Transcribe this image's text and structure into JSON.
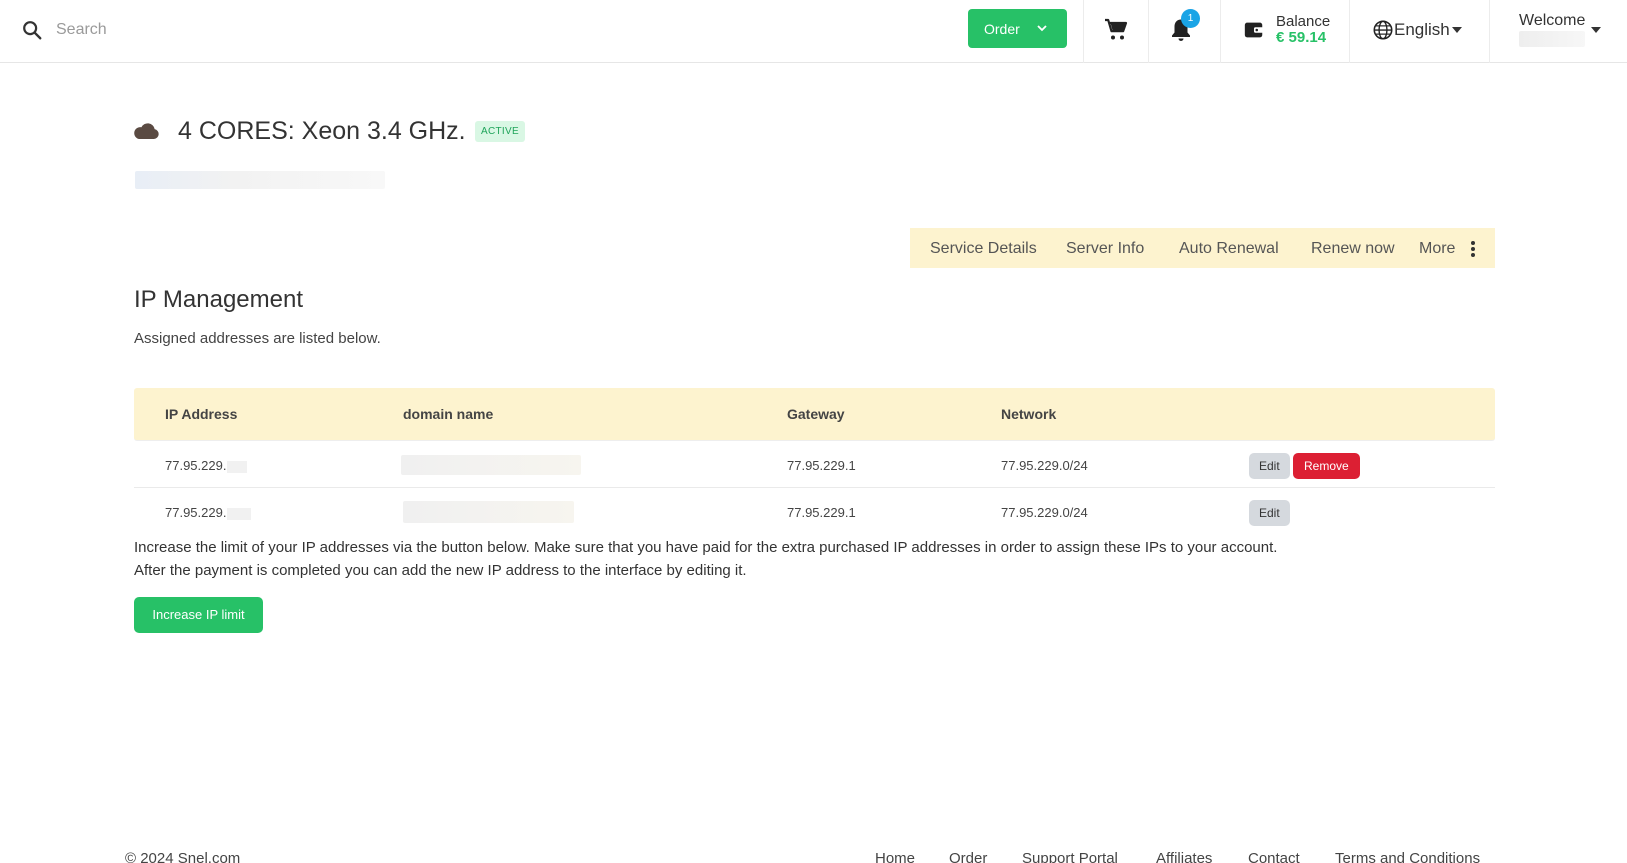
{
  "header": {
    "search_placeholder": "Search",
    "order_label": "Order",
    "notifications_count": "1",
    "balance_label": "Balance",
    "balance_value": "€ 59.14",
    "language": "English",
    "welcome_label": "Welcome",
    "icons": [
      "search-icon",
      "cart-icon",
      "bell-icon",
      "wallet-icon",
      "globe-icon",
      "chevron-down-icon"
    ]
  },
  "service": {
    "title": "4 CORES: Xeon 3.4 GHz.",
    "status": "ACTIVE",
    "icon": "cloud-icon"
  },
  "tabs": [
    {
      "label": "Service Details"
    },
    {
      "label": "Server Info"
    },
    {
      "label": "Auto Renewal"
    },
    {
      "label": "Renew now"
    },
    {
      "label": "More"
    }
  ],
  "ip_management": {
    "title": "IP Management",
    "description": "Assigned addresses are listed below.",
    "columns": [
      "IP Address",
      "domain name",
      "Gateway",
      "Network"
    ],
    "rows": [
      {
        "ip": "77.95.229.",
        "gateway": "77.95.229.1",
        "network": "77.95.229.0/24",
        "edit": "Edit",
        "remove": "Remove"
      },
      {
        "ip": "77.95.229.",
        "gateway": "77.95.229.1",
        "network": "77.95.229.0/24",
        "edit": "Edit"
      }
    ],
    "info_line_1": "Increase the limit of your IP addresses via the button below. Make sure that you have paid for the extra purchased IP addresses in order to assign these IPs to your account.",
    "info_line_2": "After the payment is completed you can add the new IP address to the interface by editing it.",
    "increase_button": "Increase IP limit"
  },
  "footer": {
    "copyright": "© 2024 Snel.com",
    "links": [
      "Home",
      "Order",
      "Support Portal",
      "Affiliates",
      "Contact",
      "Terms and Conditions"
    ]
  },
  "colors": {
    "accent_green": "#27c167",
    "danger_red": "#dc1f33",
    "highlight_yellow": "#fdf3cf",
    "badge_blue": "#1aa4e6"
  }
}
